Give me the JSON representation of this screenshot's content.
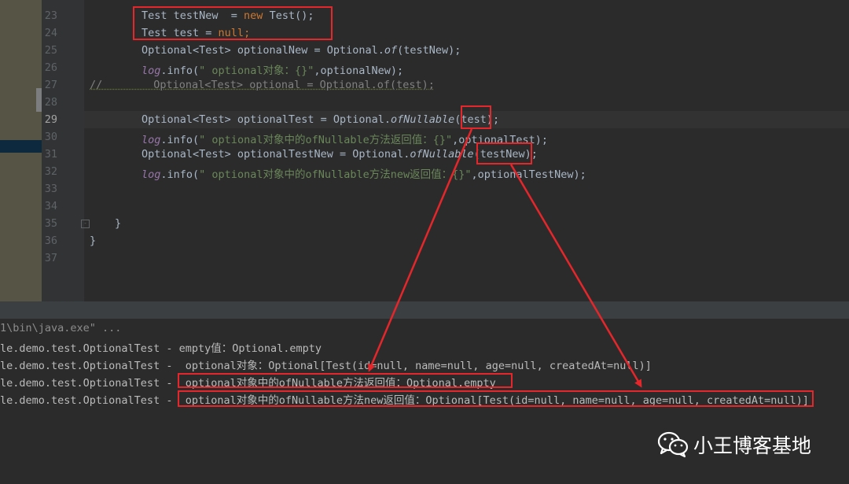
{
  "editor": {
    "line_numbers": [
      "23",
      "24",
      "25",
      "26",
      "27",
      "28",
      "29",
      "30",
      "31",
      "32",
      "33",
      "34",
      "35",
      "36",
      "37"
    ],
    "current_line": "29",
    "lines": {
      "l23": {
        "t1": "Test testNew  = ",
        "t2": "new",
        "t3": " Test();"
      },
      "l24": {
        "t1": "Test test = ",
        "t2": "null",
        "t3": ";"
      },
      "l25": {
        "t1": "Optional<Test> optionalNew = Optional.",
        "t2": "of",
        "t3": "(testNew);"
      },
      "l26": {
        "t1": "log",
        "t2": ".info(",
        "t3": "\" optional对象：{}\"",
        "t4": ",optionalNew);"
      },
      "l27": {
        "t1": "//        Optional<Test> optional = Optional.of(test);"
      },
      "l29": {
        "t1": "Optional<Test> optionalTest = Optional.",
        "t2": "ofNullable",
        "t3": "(test);"
      },
      "l30": {
        "t1": "log",
        "t2": ".info(",
        "t3": "\" optional对象中的ofNullable方法返回值：{}\"",
        "t4": ",optionalTest);"
      },
      "l31": {
        "t1": "Optional<Test> optionalTestNew = Optional.",
        "t2": "ofNullable",
        "t3": "(testNew);"
      },
      "l32": {
        "t1": "log",
        "t2": ".info(",
        "t3": "\" optional对象中的ofNullable方法new返回值：{}\"",
        "t4": ",optionalTestNew);"
      },
      "l35": {
        "t1": "}"
      },
      "l36": {
        "t1": "}"
      }
    }
  },
  "console": {
    "lines": [
      "1\\bin\\java.exe\" ...",
      "le.demo.test.OptionalTest - empty值：Optional.empty",
      "le.demo.test.OptionalTest -  optional对象：Optional[Test(id=null, name=null, age=null, createdAt=null)]",
      "le.demo.test.OptionalTest -  optional对象中的ofNullable方法返回值：Optional.empty",
      "le.demo.test.OptionalTest -  optional对象中的ofNullable方法new返回值：Optional[Test(id=null, name=null, age=null, createdAt=null)]"
    ]
  },
  "watermark": {
    "text": "小王博客基地",
    "icon": "wechat-icon"
  },
  "colors": {
    "annotation": "#e5262a",
    "keyword": "#cc7832",
    "string": "#6a8759",
    "field": "#9876aa",
    "text": "#a9b7c6"
  }
}
